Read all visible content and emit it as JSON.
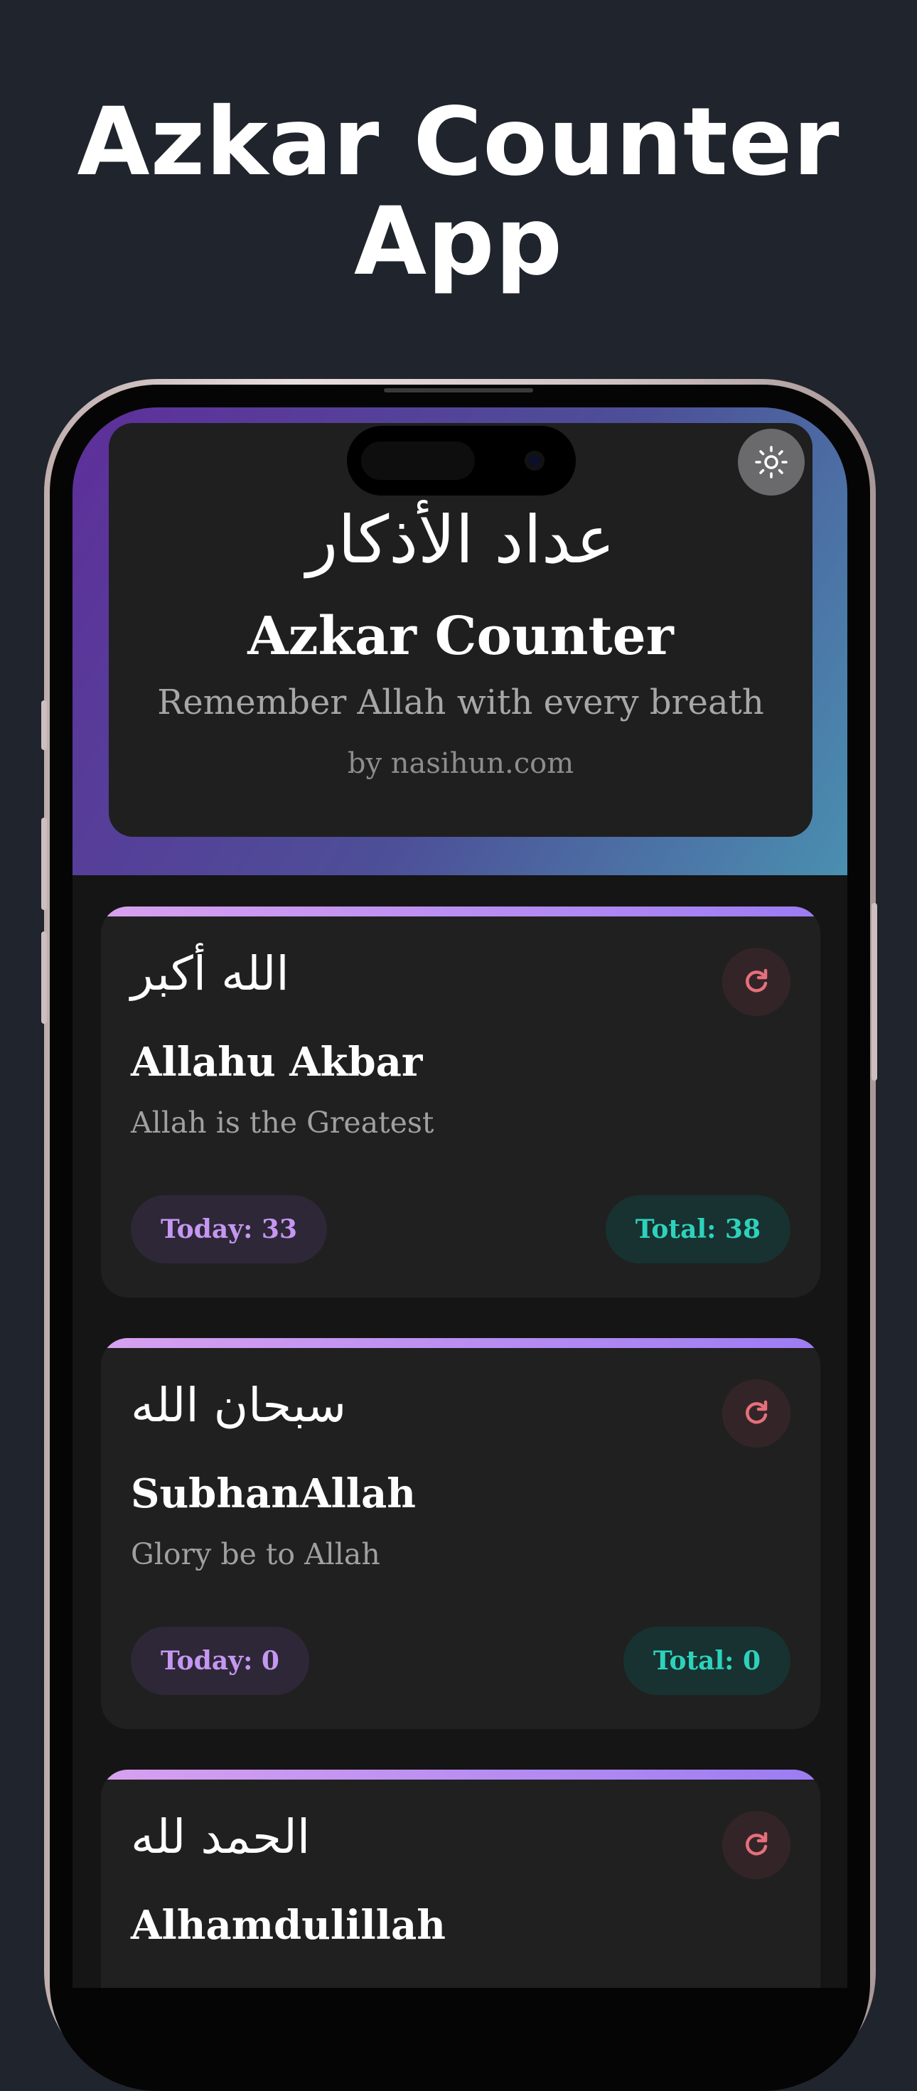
{
  "promo": {
    "title_line1": "Azkar Counter",
    "title_line2": "App"
  },
  "header": {
    "arabic_title": "عداد الأذكار",
    "app_name": "Azkar Counter",
    "tagline": "Remember Allah with every breath",
    "byline": "by nasihun.com",
    "theme_toggle_icon": "sun-icon"
  },
  "colors": {
    "background": "#20242c",
    "header_gradient_start": "#5e2f9a",
    "header_gradient_end": "#4a8fb0",
    "today_pill_text": "#c497f2",
    "total_pill_text": "#2ed2bc",
    "reset_icon": "#e66f7c"
  },
  "cards": [
    {
      "arabic": "الله أكبر",
      "transliteration": "Allahu Akbar",
      "meaning": "Allah is the Greatest",
      "today": "Today: 33",
      "total": "Total: 38"
    },
    {
      "arabic": "سبحان الله",
      "transliteration": "SubhanAllah",
      "meaning": "Glory be to Allah",
      "today": "Today: 0",
      "total": "Total: 0"
    },
    {
      "arabic": "الحمد لله",
      "transliteration": "Alhamdulillah"
    }
  ]
}
